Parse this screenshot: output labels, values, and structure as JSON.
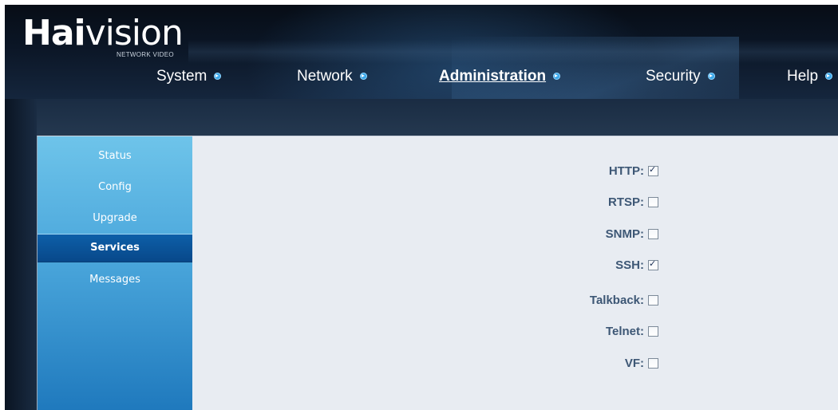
{
  "brand": {
    "logo_bold": "Hai",
    "logo_rest": "vision",
    "tagline": "NETWORK VIDEO"
  },
  "nav": [
    {
      "label": "System",
      "active": false,
      "icon": "arrow-circle-icon"
    },
    {
      "label": "Network",
      "active": false,
      "icon": "arrow-circle-icon"
    },
    {
      "label": "Administration",
      "active": true,
      "icon": "arrow-circle-icon"
    },
    {
      "label": "Security",
      "active": false,
      "icon": "arrow-circle-icon"
    },
    {
      "label": "Help",
      "active": false,
      "icon": "arrow-circle-icon"
    }
  ],
  "sidebar": {
    "items": [
      {
        "label": "Status",
        "active": false
      },
      {
        "label": "Config",
        "active": false
      },
      {
        "label": "Upgrade",
        "active": false
      },
      {
        "label": "Services",
        "active": true
      },
      {
        "label": "Messages",
        "active": false
      }
    ]
  },
  "services": [
    {
      "label": "HTTP:",
      "checked": true
    },
    {
      "label": "RTSP:",
      "checked": false
    },
    {
      "label": "SNMP:",
      "checked": false
    },
    {
      "label": "SSH:",
      "checked": true
    },
    {
      "label": "Talkback:",
      "checked": false
    },
    {
      "label": "Telnet:",
      "checked": false
    },
    {
      "label": "VF:",
      "checked": false
    }
  ],
  "colors": {
    "accent": "#3aa7ea",
    "label_text": "#3d5775",
    "sidebar_active": "#0d5fa8",
    "panel_bg": "#e8ecf2"
  }
}
